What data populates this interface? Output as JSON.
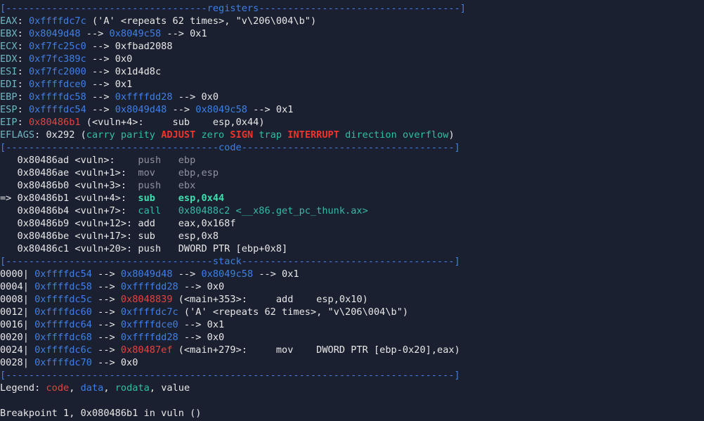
{
  "terminal": {
    "colors": {
      "background": "#1b2030",
      "default": "#e8e8e8",
      "blue": "#3f7fe6",
      "red": "#e2453c",
      "green": "#2ec0a0",
      "gray": "#8f93a0"
    },
    "lines": [
      [
        {
          "t": "[-----------------------------------",
          "c": "blue"
        },
        {
          "t": "registers",
          "c": "blue"
        },
        {
          "t": "-----------------------------------]",
          "c": "blue"
        }
      ],
      [
        {
          "t": "EAX",
          "c": "label"
        },
        {
          "t": ": ",
          "c": "default"
        },
        {
          "t": "0xffffdc7c",
          "c": "blue"
        },
        {
          "t": " ('A' <repeats 62 times>, \"v\\206\\004\\b\")",
          "c": "default"
        }
      ],
      [
        {
          "t": "EBX",
          "c": "label"
        },
        {
          "t": ": ",
          "c": "default"
        },
        {
          "t": "0x8049d48",
          "c": "blue"
        },
        {
          "t": " --> ",
          "c": "default"
        },
        {
          "t": "0x8049c58",
          "c": "blue"
        },
        {
          "t": " --> 0x1",
          "c": "default"
        }
      ],
      [
        {
          "t": "ECX",
          "c": "label"
        },
        {
          "t": ": ",
          "c": "default"
        },
        {
          "t": "0xf7fc25c0",
          "c": "blue"
        },
        {
          "t": " --> 0xfbad2088",
          "c": "default"
        }
      ],
      [
        {
          "t": "EDX",
          "c": "label"
        },
        {
          "t": ": ",
          "c": "default"
        },
        {
          "t": "0xf7fc389c",
          "c": "blue"
        },
        {
          "t": " --> 0x0",
          "c": "default"
        }
      ],
      [
        {
          "t": "ESI",
          "c": "label"
        },
        {
          "t": ": ",
          "c": "default"
        },
        {
          "t": "0xf7fc2000",
          "c": "blue"
        },
        {
          "t": " --> 0x1d4d8c",
          "c": "default"
        }
      ],
      [
        {
          "t": "EDI",
          "c": "label"
        },
        {
          "t": ": ",
          "c": "default"
        },
        {
          "t": "0xffffdce0",
          "c": "blue"
        },
        {
          "t": " --> 0x1",
          "c": "default"
        }
      ],
      [
        {
          "t": "EBP",
          "c": "label"
        },
        {
          "t": ": ",
          "c": "default"
        },
        {
          "t": "0xffffdc58",
          "c": "blue"
        },
        {
          "t": " --> ",
          "c": "default"
        },
        {
          "t": "0xffffdd28",
          "c": "blue"
        },
        {
          "t": " --> 0x0",
          "c": "default"
        }
      ],
      [
        {
          "t": "ESP",
          "c": "label"
        },
        {
          "t": ": ",
          "c": "default"
        },
        {
          "t": "0xffffdc54",
          "c": "blue"
        },
        {
          "t": " --> ",
          "c": "default"
        },
        {
          "t": "0x8049d48",
          "c": "blue"
        },
        {
          "t": " --> ",
          "c": "default"
        },
        {
          "t": "0x8049c58",
          "c": "blue"
        },
        {
          "t": " --> 0x1",
          "c": "default"
        }
      ],
      [
        {
          "t": "EIP",
          "c": "label"
        },
        {
          "t": ": ",
          "c": "default"
        },
        {
          "t": "0x80486b1",
          "c": "red"
        },
        {
          "t": " (<vuln+4>:\tsub    esp,0x44)",
          "c": "default"
        }
      ],
      [
        {
          "t": "EFLAGS",
          "c": "label"
        },
        {
          "t": ": 0x292 (",
          "c": "default"
        },
        {
          "t": "carry parity ",
          "c": "green"
        },
        {
          "t": "ADJUST",
          "c": "bold-red"
        },
        {
          "t": " zero ",
          "c": "green"
        },
        {
          "t": "SIGN",
          "c": "bold-red"
        },
        {
          "t": " trap ",
          "c": "green"
        },
        {
          "t": "INTERRUPT",
          "c": "bold-red"
        },
        {
          "t": " direction overflow",
          "c": "green"
        },
        {
          "t": ")",
          "c": "default"
        }
      ],
      [
        {
          "t": "[-------------------------------------",
          "c": "blue"
        },
        {
          "t": "code",
          "c": "blue"
        },
        {
          "t": "-------------------------------------]",
          "c": "blue"
        }
      ],
      [
        {
          "t": "   0x80486ad <vuln>:    ",
          "c": "default"
        },
        {
          "t": "push   ebp",
          "c": "gray"
        }
      ],
      [
        {
          "t": "   0x80486ae <vuln+1>:  ",
          "c": "default"
        },
        {
          "t": "mov    ebp,esp",
          "c": "gray"
        }
      ],
      [
        {
          "t": "   0x80486b0 <vuln+3>:  ",
          "c": "default"
        },
        {
          "t": "push   ebx",
          "c": "gray"
        }
      ],
      [
        {
          "t": "=> 0x80486b1 <vuln+4>:  ",
          "c": "default"
        },
        {
          "t": "sub    esp,0x44",
          "c": "bold-green"
        }
      ],
      [
        {
          "t": "   0x80486b4 <vuln+7>:  ",
          "c": "default"
        },
        {
          "t": "call   0x80488c2 <__x86.get_pc_thunk.ax>",
          "c": "teal"
        }
      ],
      [
        {
          "t": "   0x80486b9 <vuln+12>: add    eax,0x168f",
          "c": "default"
        }
      ],
      [
        {
          "t": "   0x80486be <vuln+17>: sub    esp,0x8",
          "c": "default"
        }
      ],
      [
        {
          "t": "   0x80486c1 <vuln+20>: push   DWORD PTR [ebp+0x8]",
          "c": "default"
        }
      ],
      [
        {
          "t": "[------------------------------------",
          "c": "blue"
        },
        {
          "t": "stack",
          "c": "blue"
        },
        {
          "t": "-------------------------------------]",
          "c": "blue"
        }
      ],
      [
        {
          "t": "0000| ",
          "c": "default"
        },
        {
          "t": "0xffffdc54",
          "c": "blue"
        },
        {
          "t": " --> ",
          "c": "default"
        },
        {
          "t": "0x8049d48",
          "c": "blue"
        },
        {
          "t": " --> ",
          "c": "default"
        },
        {
          "t": "0x8049c58",
          "c": "blue"
        },
        {
          "t": " --> 0x1",
          "c": "default"
        }
      ],
      [
        {
          "t": "0004| ",
          "c": "default"
        },
        {
          "t": "0xffffdc58",
          "c": "blue"
        },
        {
          "t": " --> ",
          "c": "default"
        },
        {
          "t": "0xffffdd28",
          "c": "blue"
        },
        {
          "t": " --> 0x0",
          "c": "default"
        }
      ],
      [
        {
          "t": "0008| ",
          "c": "default"
        },
        {
          "t": "0xffffdc5c",
          "c": "blue"
        },
        {
          "t": " --> ",
          "c": "default"
        },
        {
          "t": "0x8048839",
          "c": "red"
        },
        {
          "t": " (<main+353>:\tadd    esp,0x10)",
          "c": "default"
        }
      ],
      [
        {
          "t": "0012| ",
          "c": "default"
        },
        {
          "t": "0xffffdc60",
          "c": "blue"
        },
        {
          "t": " --> ",
          "c": "default"
        },
        {
          "t": "0xffffdc7c",
          "c": "blue"
        },
        {
          "t": " ('A' <repeats 62 times>, \"v\\206\\004\\b\")",
          "c": "default"
        }
      ],
      [
        {
          "t": "0016| ",
          "c": "default"
        },
        {
          "t": "0xffffdc64",
          "c": "blue"
        },
        {
          "t": " --> ",
          "c": "default"
        },
        {
          "t": "0xffffdce0",
          "c": "blue"
        },
        {
          "t": " --> 0x1",
          "c": "default"
        }
      ],
      [
        {
          "t": "0020| ",
          "c": "default"
        },
        {
          "t": "0xffffdc68",
          "c": "blue"
        },
        {
          "t": " --> ",
          "c": "default"
        },
        {
          "t": "0xffffdd28",
          "c": "blue"
        },
        {
          "t": " --> 0x0",
          "c": "default"
        }
      ],
      [
        {
          "t": "0024| ",
          "c": "default"
        },
        {
          "t": "0xffffdc6c",
          "c": "blue"
        },
        {
          "t": " --> ",
          "c": "default"
        },
        {
          "t": "0x80487ef",
          "c": "red"
        },
        {
          "t": " (<main+279>:\tmov    DWORD PTR [ebp-0x20],eax)",
          "c": "default"
        }
      ],
      [
        {
          "t": "0028| ",
          "c": "default"
        },
        {
          "t": "0xffffdc70",
          "c": "blue"
        },
        {
          "t": " --> 0x0",
          "c": "default"
        }
      ],
      [
        {
          "t": "[------------------------------------------------------------------------------]",
          "c": "blue"
        }
      ],
      [
        {
          "t": "Legend: ",
          "c": "default"
        },
        {
          "t": "code",
          "c": "red"
        },
        {
          "t": ", ",
          "c": "default"
        },
        {
          "t": "data",
          "c": "blue"
        },
        {
          "t": ", ",
          "c": "default"
        },
        {
          "t": "rodata",
          "c": "green"
        },
        {
          "t": ", value",
          "c": "default"
        }
      ],
      [
        {
          "t": "",
          "c": "default"
        }
      ],
      [
        {
          "t": "Breakpoint 1, 0x080486b1 in vuln ()",
          "c": "default"
        }
      ]
    ]
  }
}
